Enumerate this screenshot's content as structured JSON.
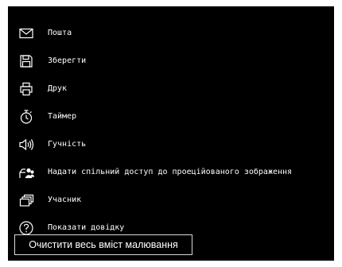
{
  "menu": {
    "items": [
      {
        "label": "Пошта",
        "icon": "mail-icon"
      },
      {
        "label": "Зберегти",
        "icon": "save-icon"
      },
      {
        "label": "Друк",
        "icon": "print-icon"
      },
      {
        "label": "Таймер",
        "icon": "timer-icon"
      },
      {
        "label": "Гучність",
        "icon": "volume-icon"
      },
      {
        "label": "Надати спільний доступ до проеційованого зображення",
        "icon": "share-projection-icon"
      },
      {
        "label": "Учасник",
        "icon": "participant-icon"
      },
      {
        "label": "Показати довідку",
        "icon": "help-icon"
      }
    ]
  },
  "actions": {
    "clear_label": "Очистити весь вміст малювання"
  },
  "colors": {
    "background": "#000000",
    "foreground": "#ffffff",
    "button_border": "#d8d8d8"
  }
}
